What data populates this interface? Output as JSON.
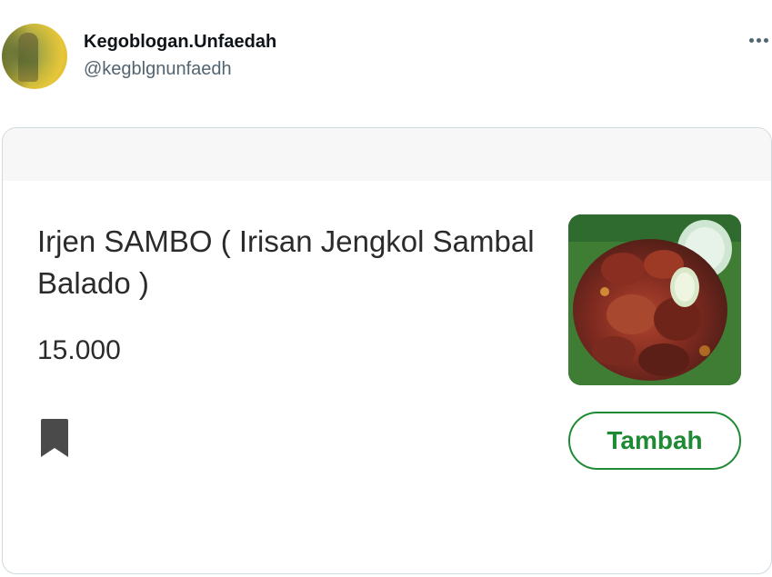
{
  "tweet": {
    "author": {
      "display_name": "Kegoblogan.Unfaedah",
      "handle": "@kegblgnunfaedh"
    },
    "more_icon": "more-horizontal-icon"
  },
  "product": {
    "name": "Irjen SAMBO ( Irisan Jengkol Sambal Balado )",
    "price": "15.000",
    "add_button_label": "Tambah",
    "bookmark_icon": "bookmark-icon"
  },
  "colors": {
    "accent_green": "#1e8a34",
    "text_dark": "#2b2b2b",
    "muted": "#536471"
  }
}
